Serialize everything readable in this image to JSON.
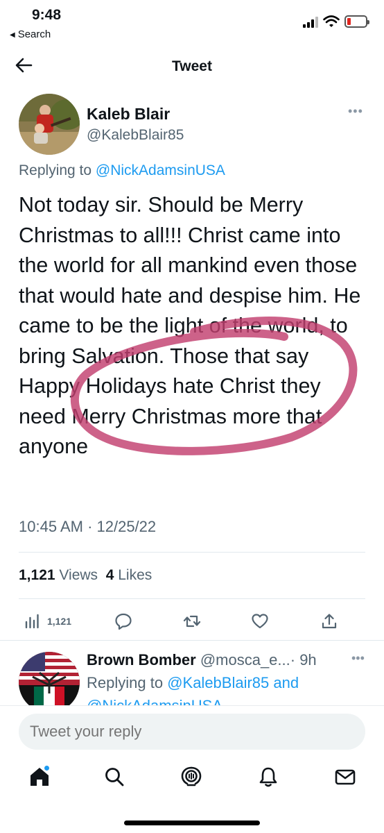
{
  "status_bar": {
    "time": "9:48",
    "back_app": "Search",
    "battery_color": "#e0261f"
  },
  "header": {
    "title": "Tweet",
    "back_icon": "arrow-left-icon"
  },
  "tweet": {
    "author_name": "Kaleb Blair",
    "author_handle": "@KalebBlair85",
    "replying_prefix": "Replying to ",
    "replying_to": "@NickAdamsinUSA",
    "text": "Not today sir. Should be Merry Christmas to all!!! Christ came into the world for all mankind even those that would hate and despise him. He came to be the light of the world, to bring Salvation. Those that say Happy Holidays hate Christ they need Merry Christmas more that anyone",
    "timestamp": "10:45 AM · 12/25/22",
    "views_count": "1,121",
    "views_label": "Views",
    "likes_count": "4",
    "likes_label": "Likes",
    "annotation_color": "#c2406f"
  },
  "actions": {
    "views_count": "1,121",
    "icons": [
      "analytics-icon",
      "reply-icon",
      "retweet-icon",
      "like-icon",
      "share-icon"
    ]
  },
  "reply": {
    "author_name": "Brown Bomber",
    "author_handle": "@mosca_e...",
    "time": "· 9h",
    "replying_prefix": "Replying to ",
    "replying_to": "@KalebBlair85 and",
    "replying_cut": "@NickAdamsinUSA"
  },
  "composer": {
    "placeholder": "Tweet your reply"
  },
  "tab_bar": {
    "icons": [
      "home-icon",
      "search-icon",
      "spaces-icon",
      "notifications-icon",
      "messages-icon"
    ],
    "accent": "#1d9bf0"
  }
}
